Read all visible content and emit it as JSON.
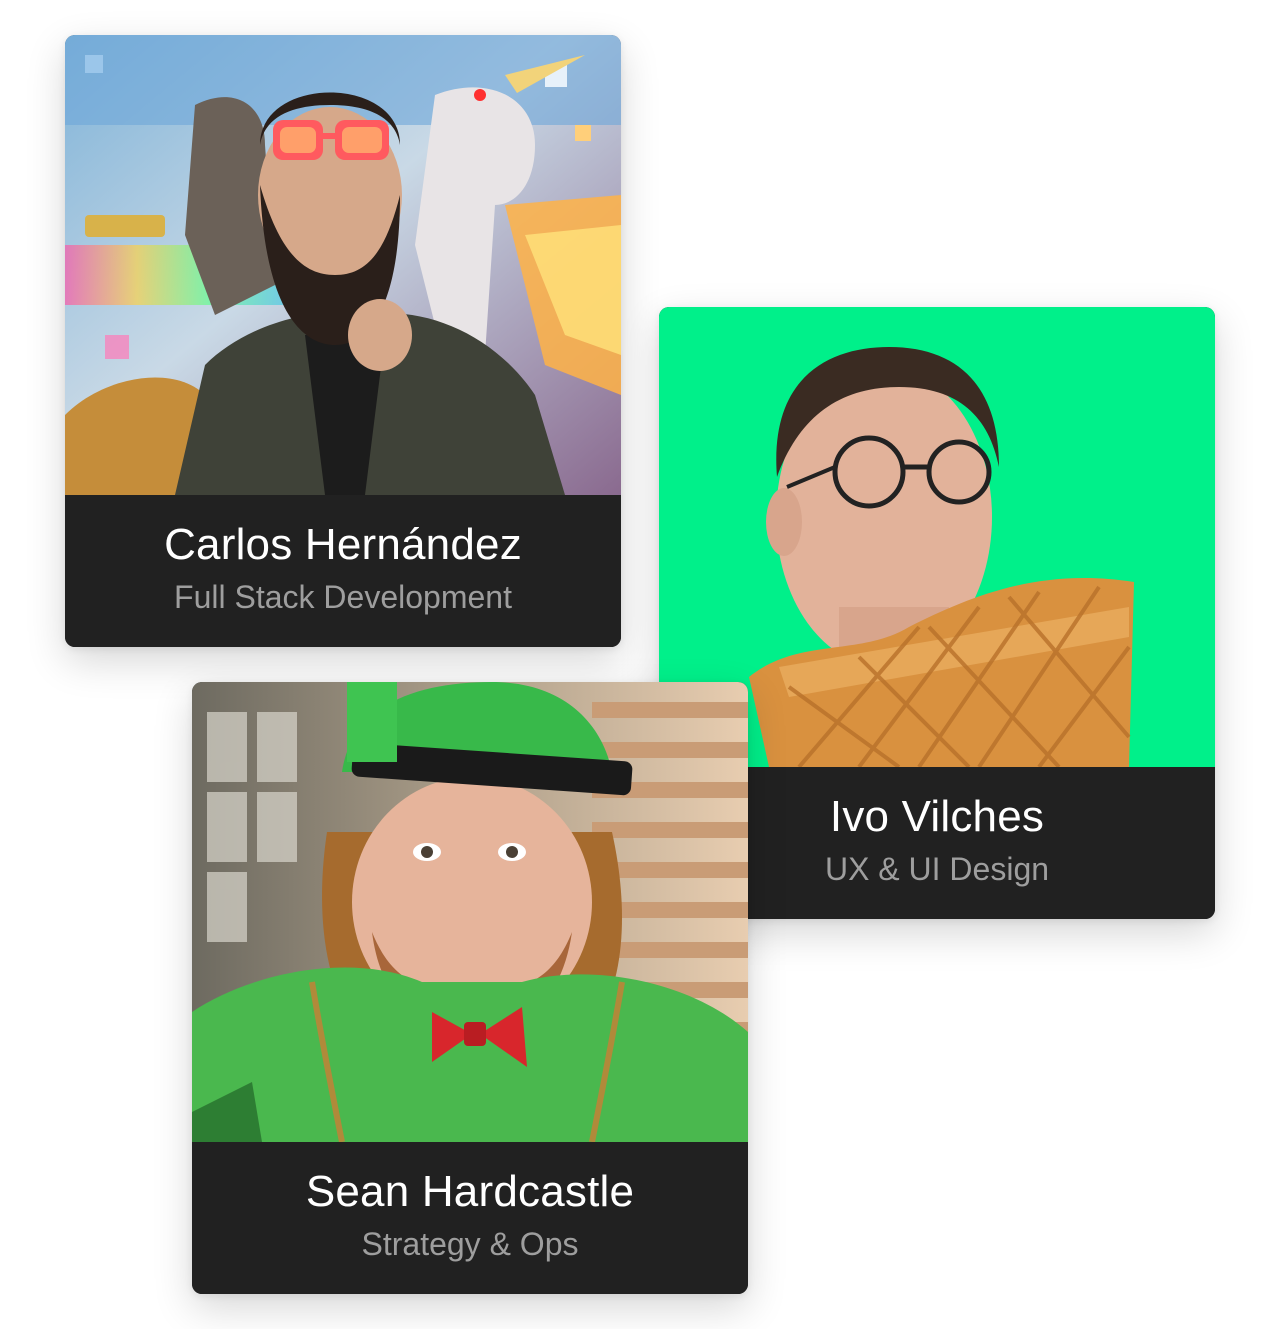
{
  "team": [
    {
      "id": "carlos",
      "name": "Carlos Hernández",
      "role": "Full Stack Development",
      "photo_icon": "portrait-photo-icon"
    },
    {
      "id": "ivo",
      "name": "Ivo Vilches",
      "role": "UX & UI Design",
      "photo_icon": "portrait-photo-icon",
      "photo_background": "#00f08a"
    },
    {
      "id": "sean",
      "name": "Sean Hardcastle",
      "role": "Strategy & Ops",
      "photo_icon": "portrait-photo-icon"
    }
  ],
  "colors": {
    "caption_background": "#212121",
    "name_text": "#ffffff",
    "role_text": "#9e9e9e",
    "page_background": "#ffffff"
  }
}
